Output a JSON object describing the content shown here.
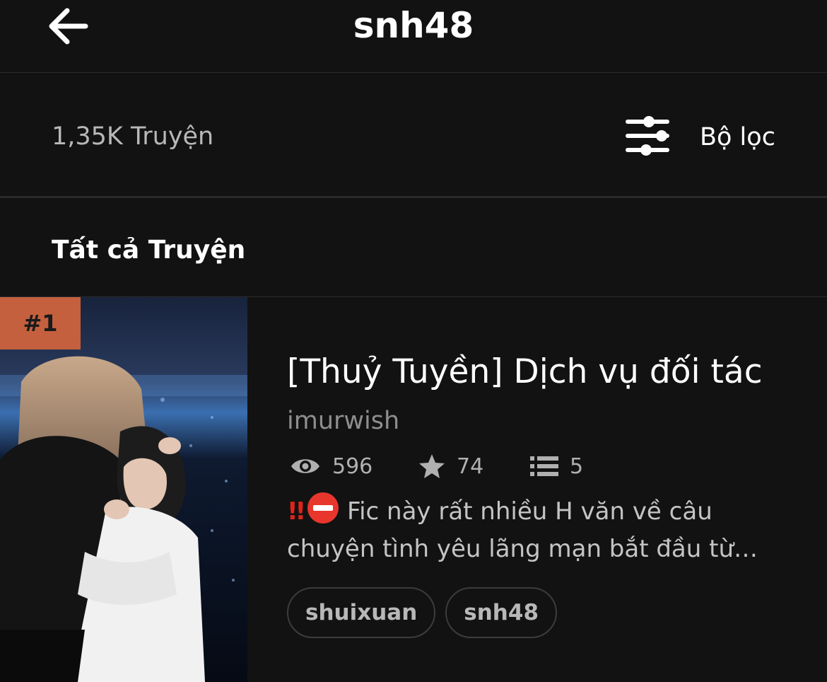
{
  "header": {
    "title": "snh48",
    "back_icon": "arrow-left-icon"
  },
  "toolbar": {
    "count": "1,35K Truyện",
    "filter_label": "Bộ lọc",
    "filter_icon": "sliders-icon"
  },
  "section": {
    "title": "Tất cả Truyện"
  },
  "stories": [
    {
      "rank": "#1",
      "title": "[Thuỷ Tuyền] Dịch vụ đối tác",
      "author": "imurwish",
      "views": "596",
      "votes": "74",
      "parts": "5",
      "description_emoji": "‼️⛔",
      "description_line1": "Fic này rất nhiều H văn về câu",
      "description_line2": "chuyện tình yêu lãng mạn bắt đầu từ…",
      "tags": [
        "shuixuan",
        "snh48"
      ]
    }
  ],
  "colors": {
    "background": "#121212",
    "rank_badge": "#c4603d",
    "secondary_text": "#8e8e8e"
  }
}
